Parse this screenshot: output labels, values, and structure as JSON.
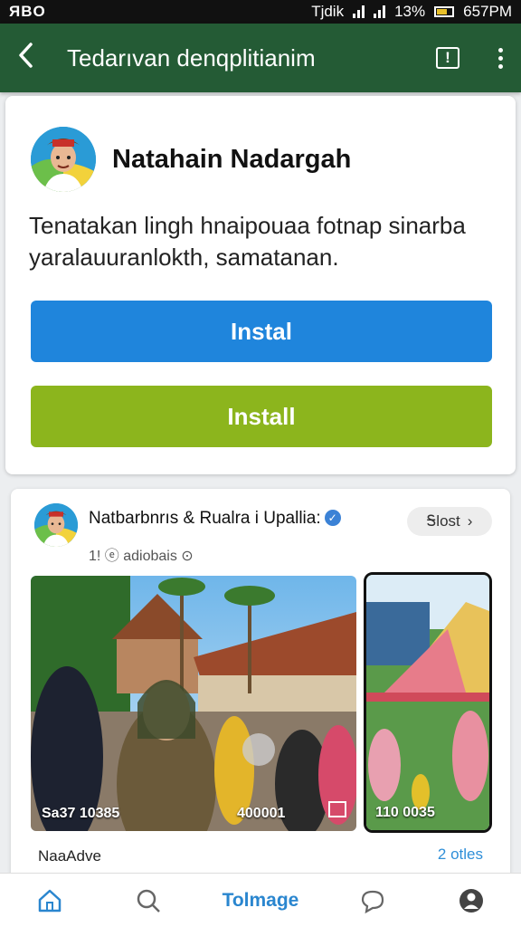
{
  "status_bar": {
    "carrier": "ЯBO",
    "network": "Tjdik",
    "battery": "13%",
    "time": "657PM"
  },
  "app_bar": {
    "title": "Tedarıvan denqplitianim"
  },
  "install_card": {
    "name": "Natahain Nadargah",
    "description": "Tenatakan lingh hnaipouaa fotnap sinarba yaralauuranlokth, samatanan.",
    "primary_button": "Instal",
    "secondary_button": "Install"
  },
  "post": {
    "page_name": "Natbarbnrıs & Rualra i Upallia:",
    "meta": "1! ⓔ adiobais ⊙",
    "follow_label": "Ꭶlost",
    "photo_main_caption_left": "Sa37 10385",
    "photo_main_caption_mid": "400001",
    "photo_side_caption": "110 0035",
    "footer_left": "NaaAdve",
    "footer_right": "2 otles"
  },
  "bottom_nav": {
    "center_label": "Tolmage"
  },
  "colors": {
    "app_bar": "#245b35",
    "primary_button": "#1f85dc",
    "secondary_button": "#8cb51d",
    "link": "#2f8fd8"
  },
  "icons": [
    "back-icon",
    "report-icon",
    "more-icon",
    "home-icon",
    "search-icon",
    "chat-icon",
    "profile-icon",
    "verified-icon",
    "chevron-right-icon"
  ]
}
